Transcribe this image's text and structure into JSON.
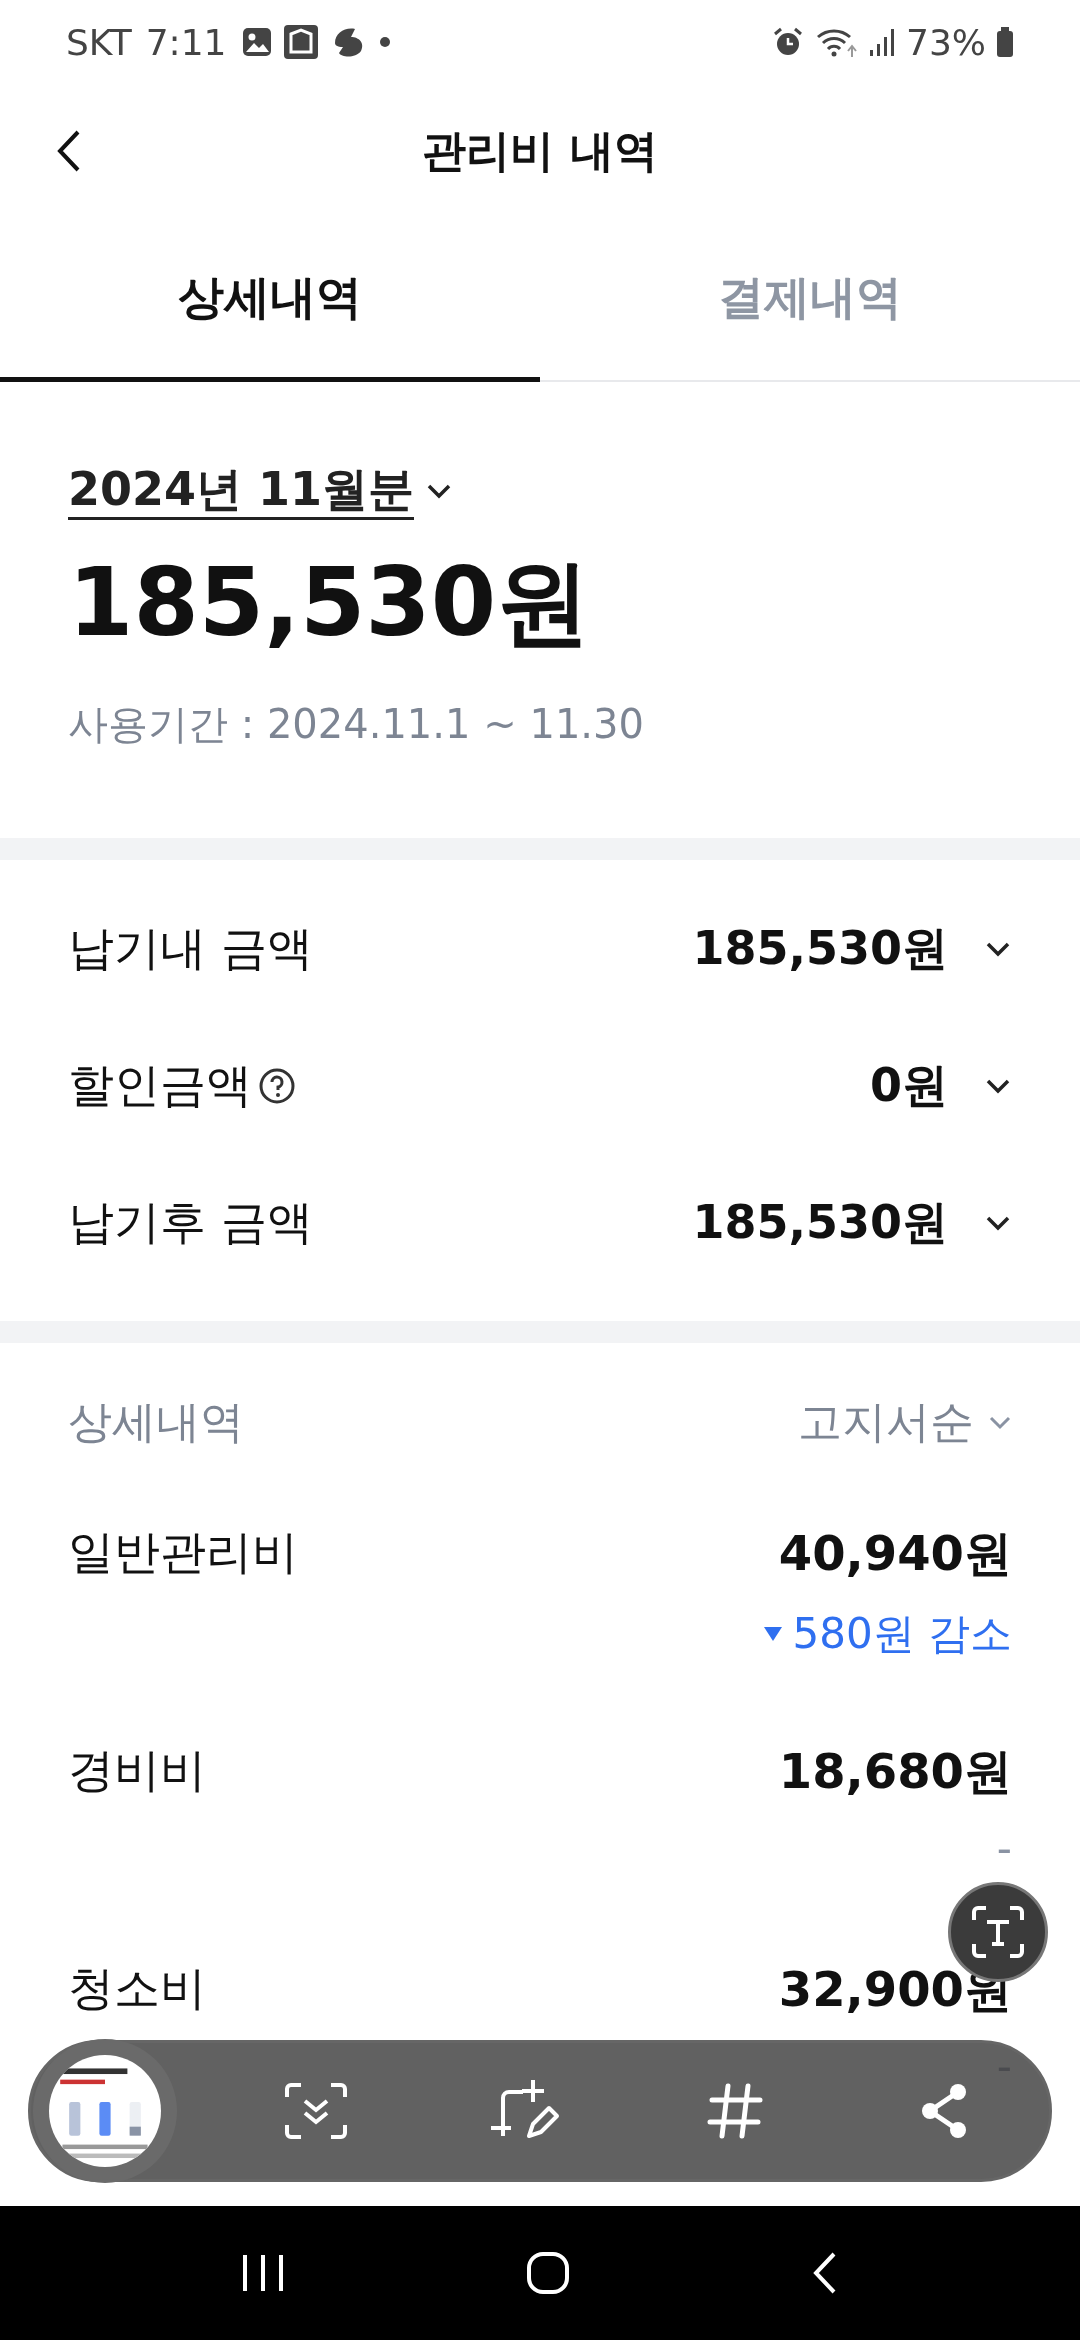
{
  "status_bar": {
    "carrier": "SKT",
    "time": "7:11",
    "battery": "73%"
  },
  "header": {
    "title": "관리비 내역"
  },
  "tabs": [
    {
      "label": "상세내역",
      "selected": true
    },
    {
      "label": "결제내역",
      "selected": false
    }
  ],
  "bill": {
    "month": "2024년 11월분",
    "amount": "185,530원",
    "period": "사용기간 : 2024.11.1 ~ 11.30"
  },
  "summary": [
    {
      "label": "납기내 금액",
      "amount": "185,530원",
      "help": false
    },
    {
      "label": "할인금액",
      "amount": "0원",
      "help": true
    },
    {
      "label": "납기후 금액",
      "amount": "185,530원",
      "help": false
    }
  ],
  "details": {
    "title": "상세내역",
    "sort": "고지서순",
    "items": [
      {
        "name": "일반관리비",
        "amount": "40,940원",
        "change": {
          "kind": "decrease",
          "text": "580원 감소"
        }
      },
      {
        "name": "경비비",
        "amount": "18,680원",
        "change": {
          "kind": "none",
          "text": "-"
        }
      },
      {
        "name": "청소비",
        "amount": "32,900원",
        "change": {
          "kind": "none",
          "text": "-"
        }
      }
    ]
  }
}
